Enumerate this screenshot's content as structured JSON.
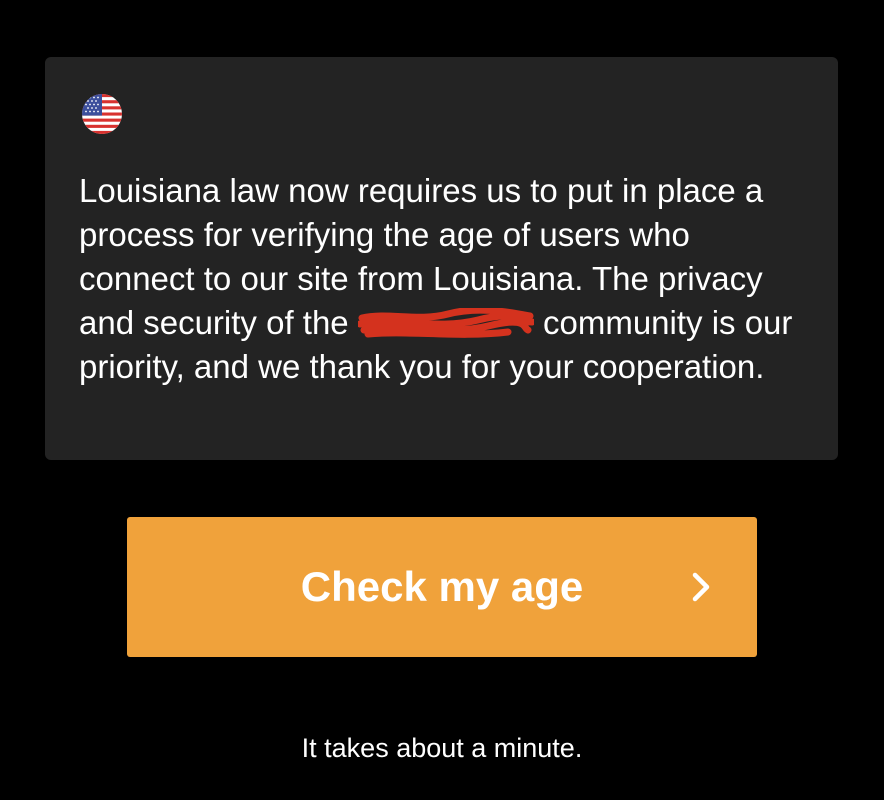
{
  "notice": {
    "flag_icon": "us-flag-icon",
    "text_before_redaction": "Louisiana law now requires us to put in place a process for verifying the age of users who connect to our site from Louisiana. The privacy and security of the ",
    "text_after_redaction": " community is our priority, and we thank you for your cooperation.",
    "redaction_color": "#d4321e"
  },
  "cta": {
    "label": "Check my age",
    "icon": "chevron-right-icon",
    "color": "#f0a23b"
  },
  "footnote": "It takes about a minute."
}
